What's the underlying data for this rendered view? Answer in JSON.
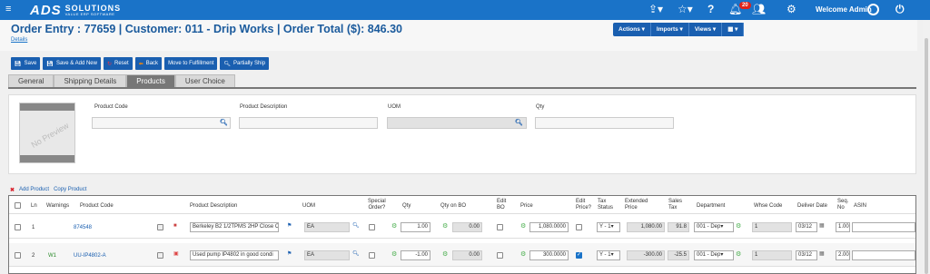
{
  "topbar": {
    "hamburger": "≡",
    "logo_main": "ADS",
    "logo_brand": "SOLUTIONS",
    "logo_tag": "VALUE ERP SOFTWARE",
    "notif_count": "20",
    "welcome": "Welcome Admin",
    "icons": [
      "share-icon",
      "star-icon",
      "help-icon",
      "bell-icon",
      "users-icon",
      "gear-icon",
      "user-icon",
      "power-icon"
    ]
  },
  "header": {
    "title": "Order Entry : 77659 | Customer: 011 - Drip Works | Order Total ($): 846.30",
    "details": "Details",
    "actions": [
      "Actions ▾",
      "Imports ▾",
      "Views ▾",
      "▾"
    ]
  },
  "toolbar": {
    "save": "Save",
    "save_add": "Save & Add New",
    "reset": "Reset",
    "back": "Back",
    "move": "Move to Fulfillment",
    "partial": "Partially Ship"
  },
  "tabs": [
    "General",
    "Shipping Details",
    "Products",
    "User Choice"
  ],
  "active_tab": "Products",
  "form": {
    "preview_text": "No Preview",
    "product_code_label": "Product Code",
    "product_desc_label": "Product Description",
    "uom_label": "UOM",
    "qty_label": "Qty"
  },
  "links": {
    "add": "Add Product",
    "copy": "Copy Product"
  },
  "grid": {
    "headers": {
      "ln": "Ln",
      "warnings": "Warnings",
      "product_code": "Product Code",
      "product_desc": "Product Description",
      "uom": "UOM",
      "special": "Special\nOrder?",
      "qty": "Qty",
      "qty_bo": "Qty on BO",
      "edit_bo": "Edit\nBO",
      "price": "Price",
      "edit_price": "Edit\nPrice?",
      "tax_status": "Tax\nStatus",
      "ext_price": "Extended\nPrice",
      "sales_tax": "Sales\nTax",
      "department": "Department",
      "whse": "Whse Code",
      "deliver": "Deliver Date",
      "seq": "Seq.\nNo",
      "asin": "ASIN"
    },
    "rows": [
      {
        "ln": "1",
        "warning": "",
        "code": "874548",
        "desc": "Berkeley B2 1/2TPMS 2HP Close C",
        "uom": "EA",
        "qty": "1.00",
        "qty_bo": "0.00",
        "price": "1,080.0000",
        "edit_price": false,
        "tax": "Y - 1",
        "ext": "1,080.00",
        "stax": "91.8",
        "dept": "001 - Dep",
        "whse": "1",
        "date": "03/12",
        "seq": "1.00"
      },
      {
        "ln": "2",
        "warning": "W1",
        "code": "UU-IP4802-A",
        "desc": "Used pump IP4802 in good condi",
        "uom": "EA",
        "qty": "-1.00",
        "qty_bo": "0.00",
        "price": "300.0000",
        "edit_price": true,
        "tax": "Y - 1",
        "ext": "-300.00",
        "stax": "-25.5",
        "dept": "001 - Dep",
        "whse": "1",
        "date": "03/12",
        "seq": "2.00"
      }
    ]
  }
}
